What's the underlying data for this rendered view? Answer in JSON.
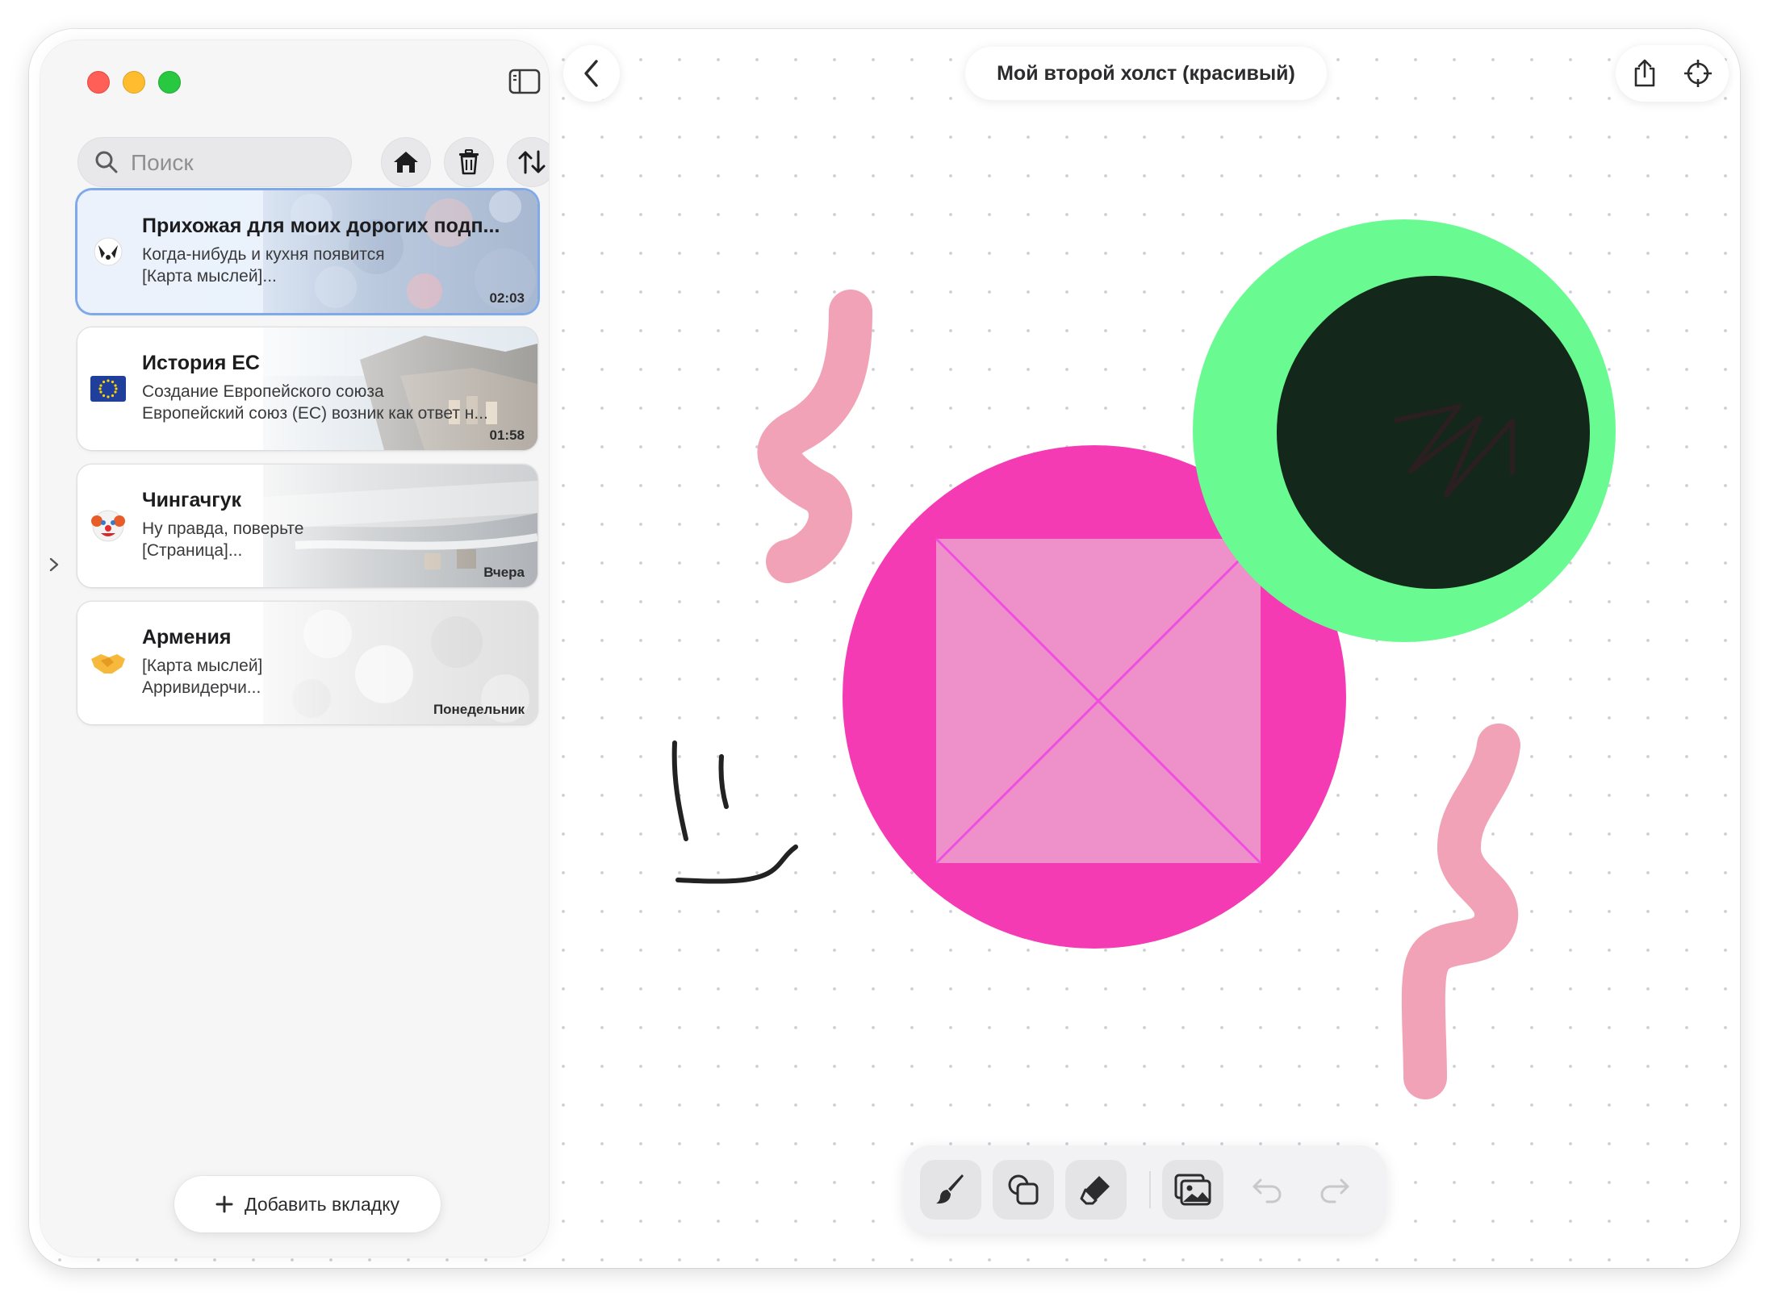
{
  "window": {
    "title": "Мой второй холст (красивый)"
  },
  "sidebar": {
    "search_placeholder": "Поиск",
    "add_tab_label": "Добавить вкладку",
    "cards": [
      {
        "emoji": "badger-face",
        "title": "Прихожая для моих дорогих подп...",
        "line1": "Когда-нибудь и кухня появится",
        "line2": "[Карта мыслей]...",
        "time": "02:03",
        "active": true
      },
      {
        "emoji": "eu-flag",
        "title": "История ЕС",
        "line1": "Создание Европейского союза",
        "line2": "Европейский союз (ЕС) возник как ответ н...",
        "time": "01:58",
        "active": false
      },
      {
        "emoji": "clown-face",
        "title": "Чингачгук",
        "line1": "Ну правда, поверьте",
        "line2": "[Страница]...",
        "time": "Вчера",
        "active": false
      },
      {
        "emoji": "handshake",
        "title": "Армения",
        "line1": "[Карта мыслей]",
        "line2": "Арривидерчи...",
        "time": "Понедельник",
        "active": false
      }
    ]
  },
  "toolbar": {
    "tools": [
      "brush-icon",
      "shapes-icon",
      "eraser-icon",
      "image-icon",
      "undo-icon",
      "redo-icon"
    ],
    "undo_enabled": false,
    "redo_enabled": false
  },
  "colors": {
    "accent_blue": "#7fa9e8",
    "magenta_circle": "#f53bb3",
    "pink_square": "#ee90c9",
    "green_ring": "#69fb92",
    "dark_circle": "#13271a",
    "pink_stroke": "#f2a2b6",
    "black_stroke": "#222222"
  }
}
